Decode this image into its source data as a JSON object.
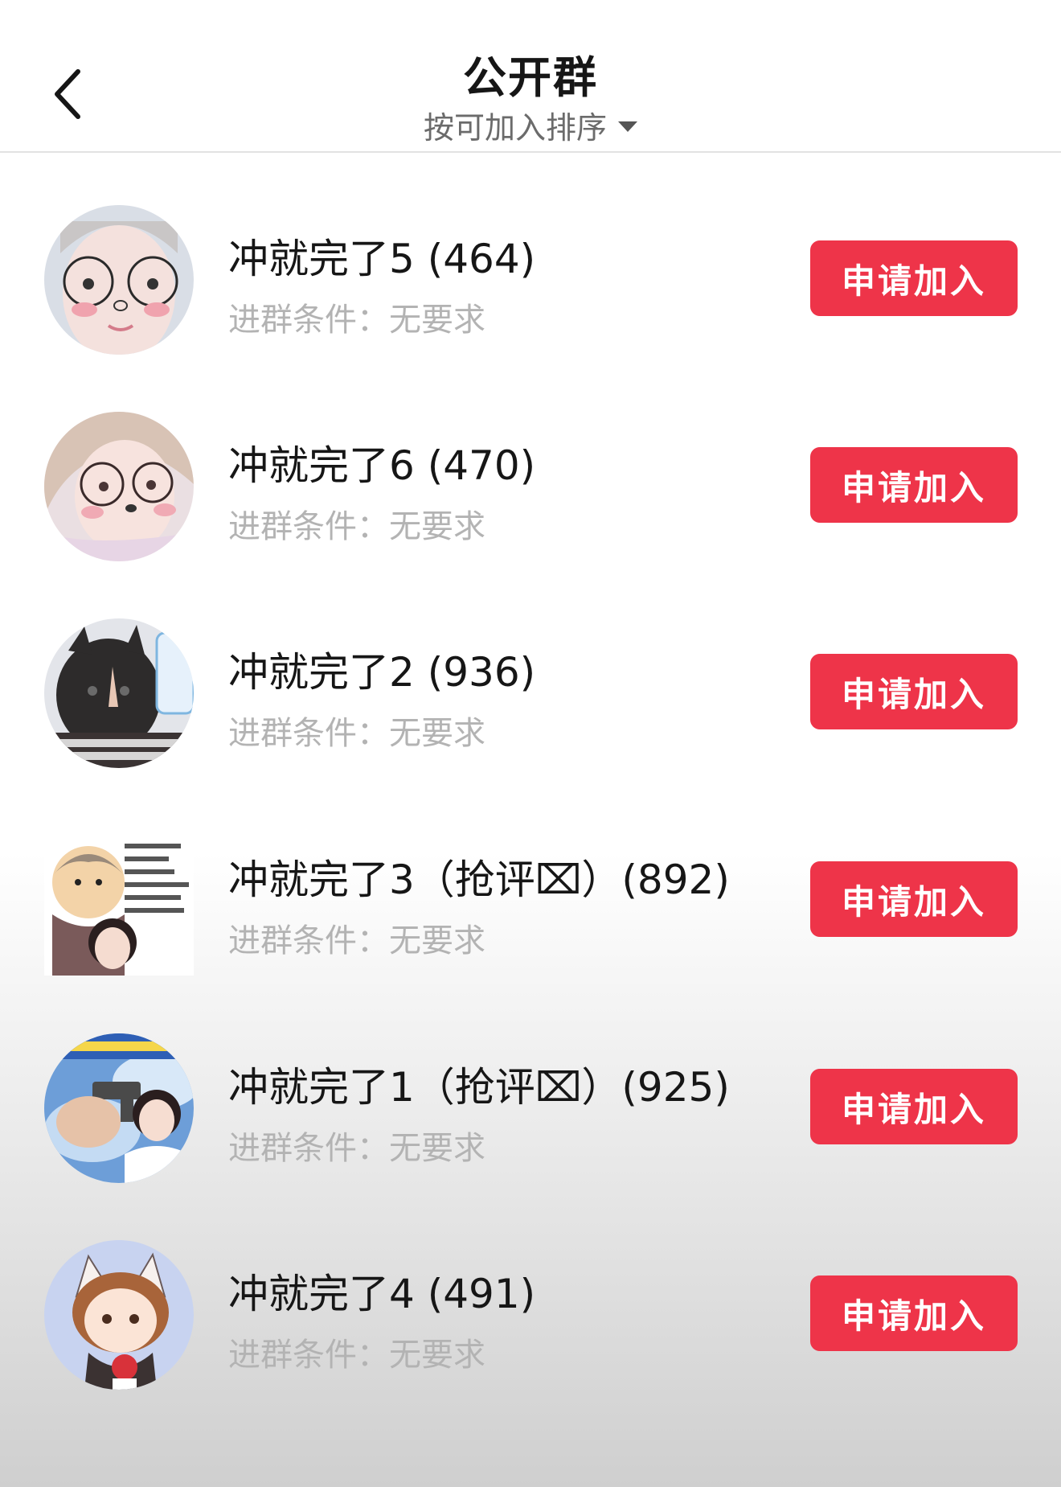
{
  "header": {
    "title": "公开群",
    "sort_label": "按可加入排序"
  },
  "groups": [
    {
      "name": "冲就完了5 (464)",
      "condition": "进群条件：无要求",
      "button": "申请加入"
    },
    {
      "name": "冲就完了6 (470)",
      "condition": "进群条件：无要求",
      "button": "申请加入"
    },
    {
      "name": "冲就完了2 (936)",
      "condition": "进群条件：无要求",
      "button": "申请加入"
    },
    {
      "name": "冲就完了3（抢评⌧）(892)",
      "condition": "进群条件：无要求",
      "button": "申请加入"
    },
    {
      "name": "冲就完了1（抢评⌧）(925)",
      "condition": "进群条件：无要求",
      "button": "申请加入"
    },
    {
      "name": "冲就完了4 (491)",
      "condition": "进群条件：无要求",
      "button": "申请加入"
    }
  ],
  "colors": {
    "accent": "#ee3449",
    "title": "#161616",
    "subtle": "#b3b3b3"
  },
  "icons": {
    "back": "chevron-left-icon",
    "sort": "caret-down-icon"
  }
}
